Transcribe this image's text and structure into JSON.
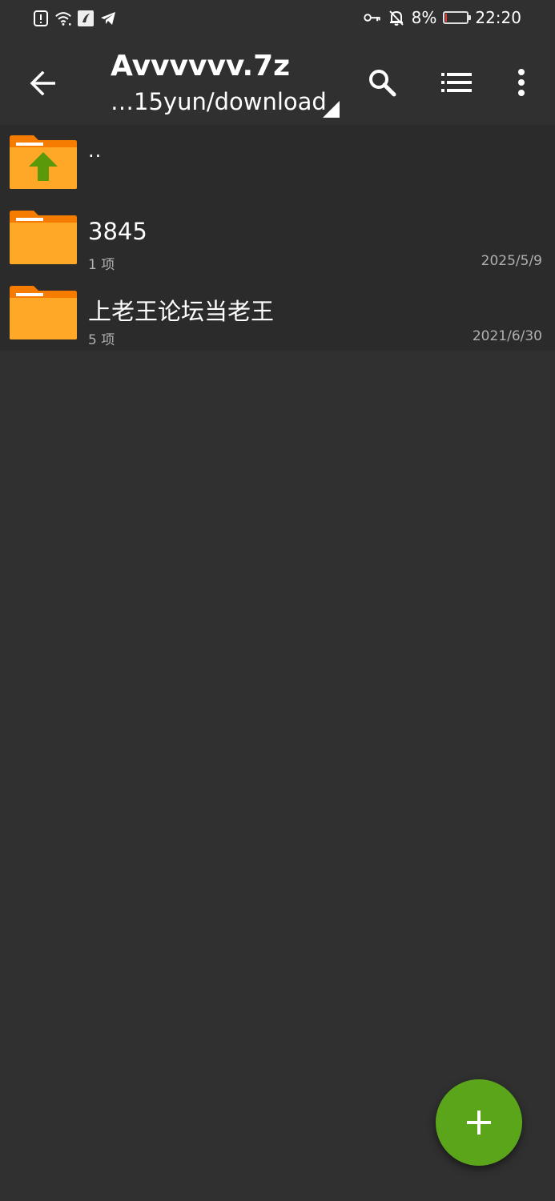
{
  "status_bar": {
    "time": "22:20",
    "battery_percent": "8%",
    "battery_level": 0.08,
    "left_icons": [
      "alert-icon",
      "wifi-icon",
      "app-notification-icon",
      "telegram-icon"
    ],
    "right_icons": [
      "key-icon",
      "bell-off-icon",
      "battery-icon"
    ]
  },
  "app_bar": {
    "title": "Avvvvvv.7z",
    "subtitle": "…15yun/download",
    "actions": [
      "back-icon",
      "search-icon",
      "list-view-icon",
      "more-vert-icon"
    ]
  },
  "files": [
    {
      "name": "..",
      "count": "",
      "date": "",
      "type": "parent-folder"
    },
    {
      "name": "3845",
      "count": "1 项",
      "date": "2025/5/9",
      "type": "folder"
    },
    {
      "name": "上老王论坛当老王",
      "count": "5 项",
      "date": "2021/6/30",
      "type": "folder"
    }
  ],
  "fab": {
    "icon": "plus-icon",
    "color": "#5aa51a"
  },
  "colors": {
    "background": "#303030",
    "list_background": "#2b2b2b",
    "folder_orange": "#ffa726",
    "folder_dark": "#f57c00",
    "accent_green": "#5aa51a"
  }
}
